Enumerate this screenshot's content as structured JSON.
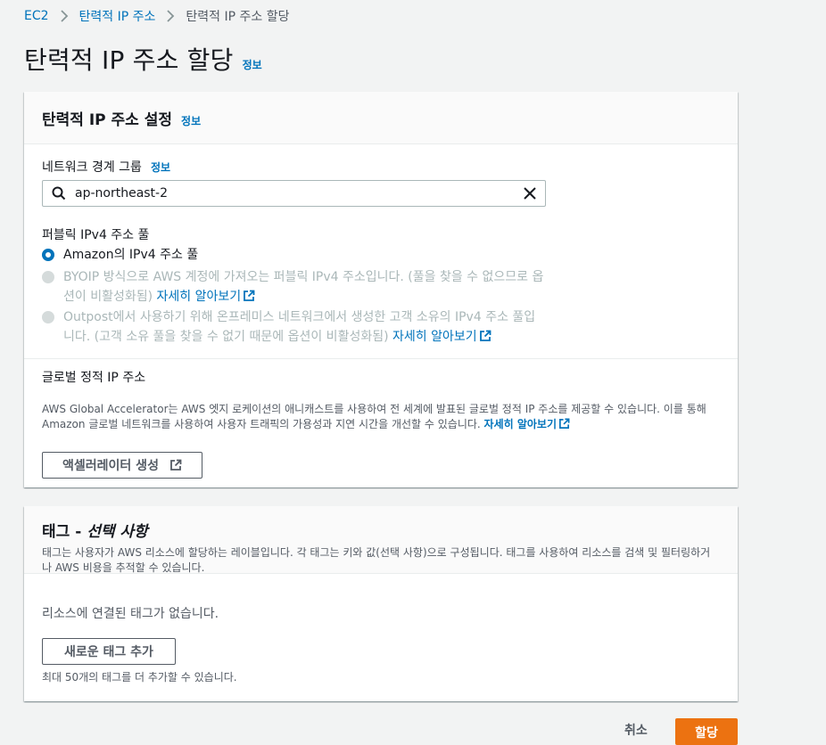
{
  "breadcrumb": {
    "items": [
      "EC2",
      "탄력적 IP 주소",
      "탄력적 IP 주소 할당"
    ]
  },
  "page": {
    "title": "탄력적 IP 주소 할당",
    "info": "정보"
  },
  "settings": {
    "title": "탄력적 IP 주소 설정",
    "info": "정보",
    "network_border_group": {
      "label": "네트워크 경계 그룹",
      "info": "정보",
      "value": "ap-northeast-2"
    },
    "pool": {
      "label": "퍼블릭 IPv4 주소 풀",
      "options": [
        {
          "text": "Amazon의 IPv4 주소 풀",
          "selected": true,
          "disabled": false
        },
        {
          "text": "BYOIP 방식으로 AWS 계정에 가져오는 퍼블릭 IPv4 주소입니다. (풀을 찾을 수 없으므로 옵션이 비활성화됨)",
          "link": "자세히 알아보기",
          "selected": false,
          "disabled": true
        },
        {
          "text": "Outpost에서 사용하기 위해 온프레미스 네트워크에서 생성한 고객 소유의 IPv4 주소 풀입니다. (고객 소유 풀을 찾을 수 없기 때문에 옵션이 비활성화됨)",
          "link": "자세히 알아보기",
          "selected": false,
          "disabled": true
        }
      ]
    },
    "global": {
      "label": "글로벌 정적 IP 주소",
      "description": "AWS Global Accelerator는 AWS 엣지 로케이션의 애니캐스트를 사용하여 전 세계에 발표된 글로벌 정적 IP 주소를 제공할 수 있습니다. 이를 통해 Amazon 글로벌 네트워크를 사용하여 사용자 트래픽의 가용성과 지연 시간을 개선할 수 있습니다.",
      "link": "자세히 알아보기",
      "button": "액셀러레이터 생성"
    }
  },
  "tags": {
    "title": "태그 - ",
    "title_optional": "선택 사항",
    "description": "태그는 사용자가 AWS 리소스에 할당하는 레이블입니다. 각 태그는 키와 값(선택 사항)으로 구성됩니다. 태그를 사용하여 리소스를 검색 및 필터링하거나 AWS 비용을 추적할 수 있습니다.",
    "empty": "리소스에 연결된 태그가 없습니다.",
    "add_button": "새로운 태그 추가",
    "limit": "최대 50개의 태그를 더 추가할 수 있습니다."
  },
  "footer": {
    "cancel": "취소",
    "primary": "할당"
  },
  "colors": {
    "link": "#0073bb",
    "primary": "#ec7211",
    "background": "#f2f3f3"
  }
}
